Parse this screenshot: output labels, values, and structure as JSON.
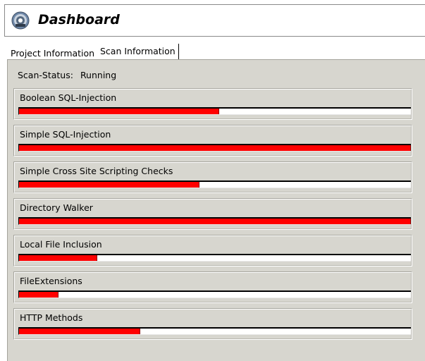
{
  "header": {
    "title": "Dashboard",
    "icon": "scanner-app-icon"
  },
  "tabs": [
    {
      "label": "Project Information",
      "selected": false
    },
    {
      "label": "Scan Information",
      "selected": true
    }
  ],
  "scan": {
    "status_label": "Scan-Status:",
    "status_value": "Running"
  },
  "colors": {
    "progress_fill": "#ff0000",
    "panel_bg": "#d7d6cf"
  },
  "modules": [
    {
      "name": "Boolean SQL-Injection",
      "progress": 0.51
    },
    {
      "name": "Simple SQL-Injection",
      "progress": 1.0
    },
    {
      "name": "Simple Cross Site Scripting Checks",
      "progress": 0.46
    },
    {
      "name": "Directory Walker",
      "progress": 1.0
    },
    {
      "name": "Local File Inclusion",
      "progress": 0.2
    },
    {
      "name": "FileExtensions",
      "progress": 0.1
    },
    {
      "name": "HTTP Methods",
      "progress": 0.31
    }
  ]
}
